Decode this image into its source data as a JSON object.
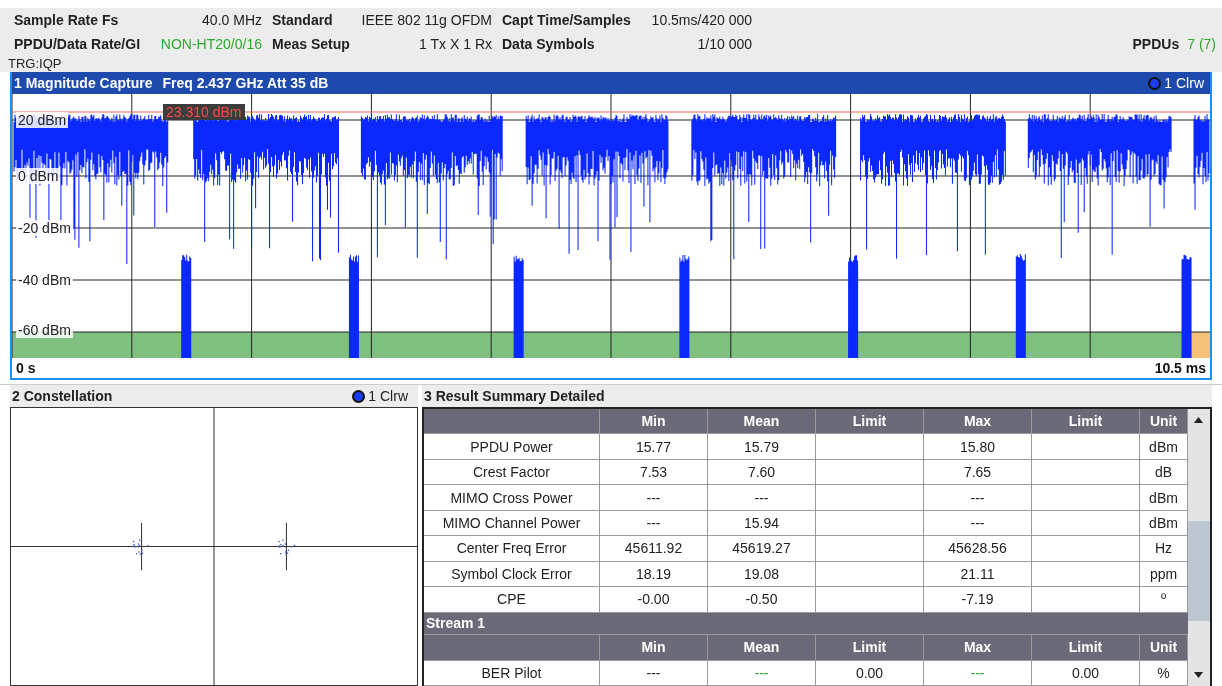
{
  "info": {
    "columns": [
      [
        {
          "label": "Sample Rate Fs",
          "value": "40.0 MHz",
          "highlight": false
        },
        {
          "label": "PPDU/Data Rate/GI",
          "value": "NON-HT20/0/16",
          "highlight": true
        }
      ],
      [
        {
          "label": "Standard",
          "value": "IEEE 802 11g OFDM",
          "highlight": false
        },
        {
          "label": "Meas Setup",
          "value": "1 Tx X 1 Rx",
          "highlight": false
        }
      ],
      [
        {
          "label": "Capt Time/Samples",
          "value": "10.5ms/420 000",
          "highlight": false
        },
        {
          "label": "Data Symbols",
          "value": "1/10 000",
          "highlight": false
        }
      ]
    ],
    "ppdus": {
      "label": "PPDUs",
      "value": "7 (7)",
      "highlight": true
    },
    "trigger": "TRG:IQP"
  },
  "magnitude": {
    "title": "1 Magnitude Capture",
    "settings": "Freq 2.437 GHz Att 35 dB",
    "trace": {
      "label": "1 Clrw",
      "color": "#1a3cf0"
    },
    "y_labels": [
      "20 dBm",
      "0 dBm",
      "-20 dBm",
      "-40 dBm",
      "-60 dBm"
    ],
    "marker": "23.310 dBm",
    "x_start": "0 s",
    "x_end": "10.5 ms"
  },
  "constellation": {
    "title": "2 Constellation",
    "trace": {
      "label": "1 Clrw",
      "color": "#1a3cf0"
    }
  },
  "results": {
    "title": "3 Result Summary Detailed",
    "rows": [
      {
        "kind": "header",
        "cells": [
          "",
          "Min",
          "Mean",
          "Limit",
          "Max",
          "Limit",
          "Unit"
        ]
      },
      {
        "kind": "data",
        "cells": [
          "PPDU Power",
          "15.77",
          "15.79",
          "",
          "15.80",
          "",
          "dBm"
        ]
      },
      {
        "kind": "data",
        "cells": [
          "Crest Factor",
          "7.53",
          "7.60",
          "",
          "7.65",
          "",
          "dB"
        ]
      },
      {
        "kind": "data",
        "cells": [
          "MIMO Cross Power",
          "---",
          "---",
          "",
          "---",
          "",
          "dBm"
        ]
      },
      {
        "kind": "data",
        "cells": [
          "MIMO Channel Power",
          "---",
          "15.94",
          "",
          "---",
          "",
          "dBm"
        ]
      },
      {
        "kind": "data",
        "cells": [
          "Center Freq Error",
          "45611.92",
          "45619.27",
          "",
          "45628.56",
          "",
          "Hz"
        ]
      },
      {
        "kind": "data",
        "cells": [
          "Symbol Clock Error",
          "18.19",
          "19.08",
          "",
          "21.11",
          "",
          "ppm"
        ]
      },
      {
        "kind": "data",
        "cells": [
          "CPE",
          "-0.00",
          "-0.50",
          "",
          "-7.19",
          "",
          "º"
        ]
      },
      {
        "kind": "section",
        "cells": [
          "Stream 1"
        ]
      },
      {
        "kind": "header",
        "cells": [
          "",
          "Min",
          "Mean",
          "Limit",
          "Max",
          "Limit",
          "Unit"
        ]
      },
      {
        "kind": "data",
        "cells": [
          "BER Pilot",
          "---",
          {
            "text": "---",
            "pass": true
          },
          "0.00",
          {
            "text": "---",
            "pass": true
          },
          "0.00",
          "%"
        ]
      }
    ]
  }
}
